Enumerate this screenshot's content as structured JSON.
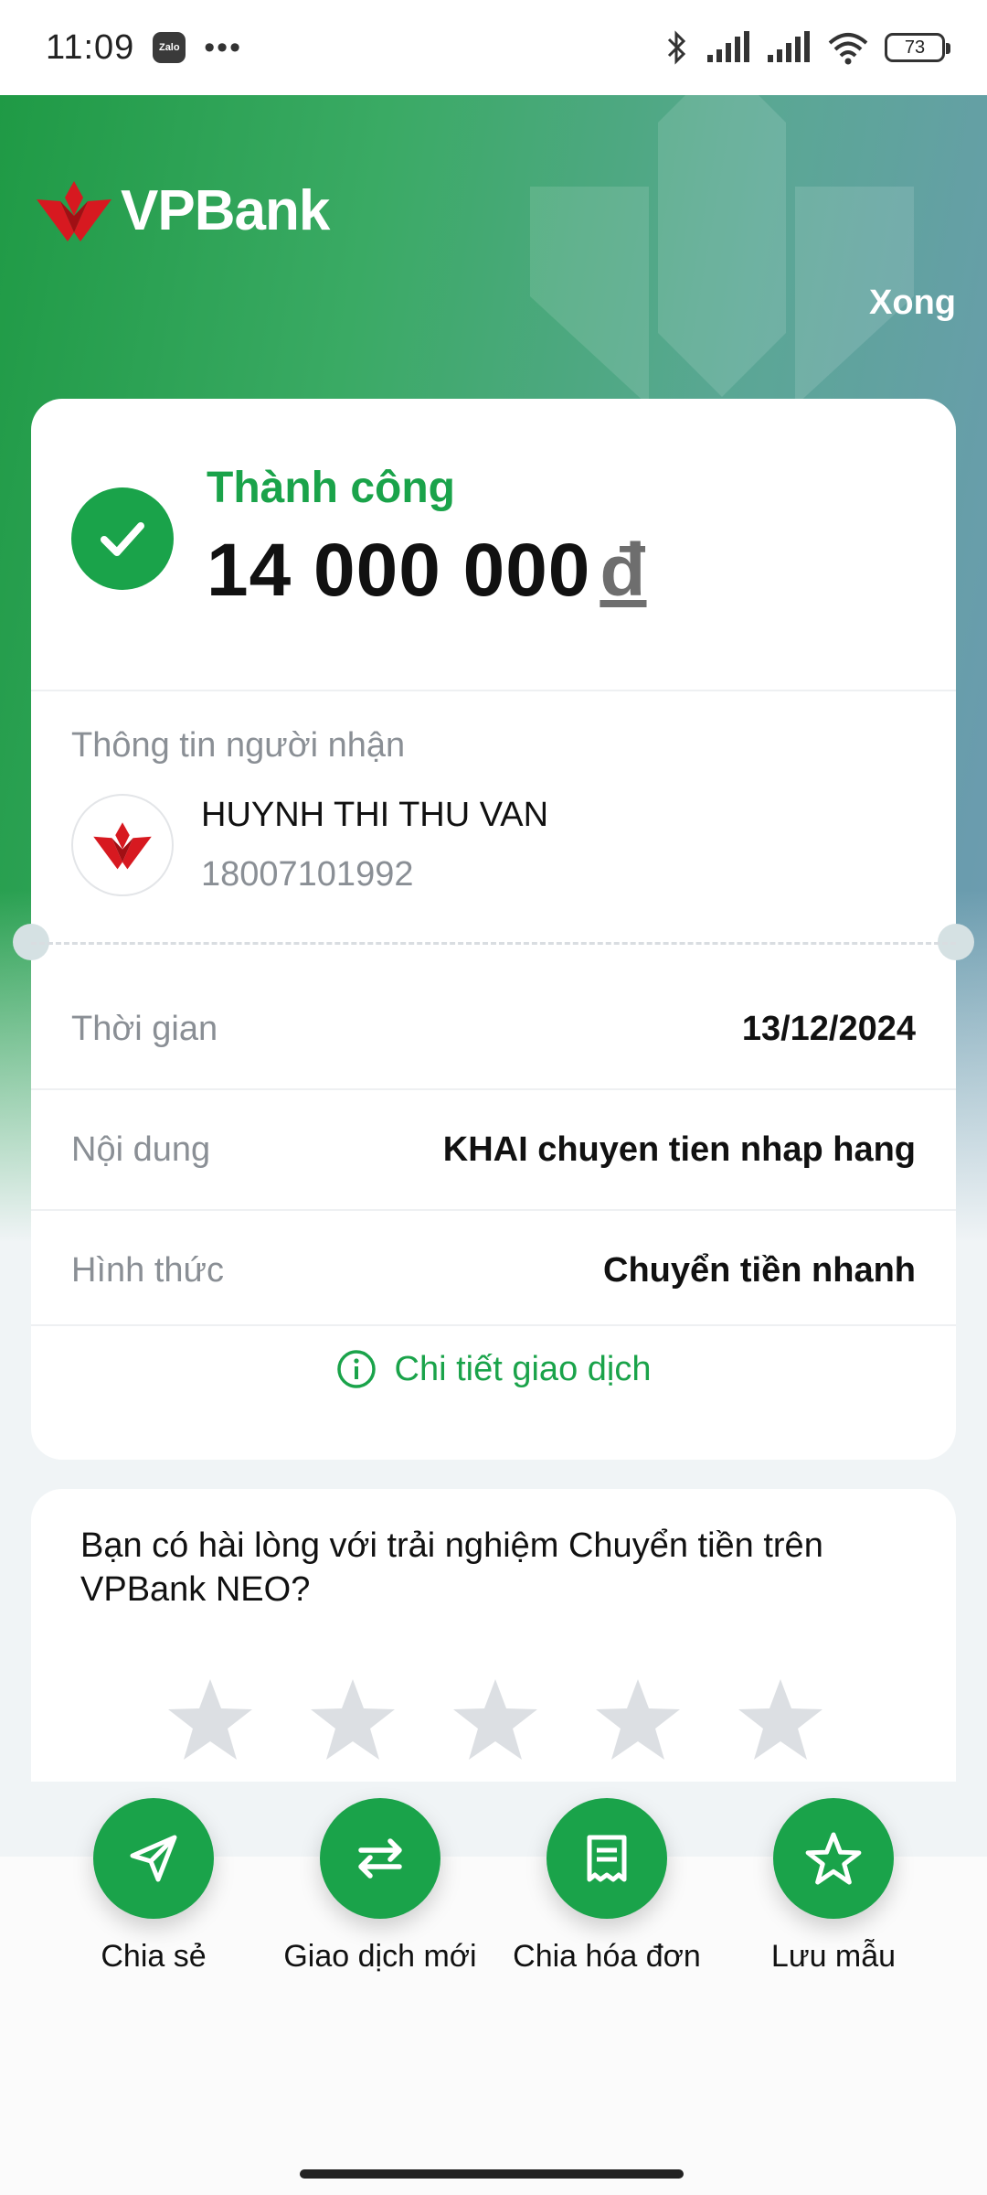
{
  "status_bar": {
    "time": "11:09",
    "notification_badge": "Zalo",
    "more_indicator": "•••",
    "battery": "73"
  },
  "header": {
    "brand": "VPBank",
    "done_label": "Xong"
  },
  "result": {
    "status": "Thành công",
    "amount": "14 000 000",
    "currency": "đ"
  },
  "recipient": {
    "section_title": "Thông tin người nhận",
    "name": "HUYNH THI THU VAN",
    "account": "18007101992"
  },
  "details": [
    {
      "label": "Thời gian",
      "value": "13/12/2024"
    },
    {
      "label": "Nội dung",
      "value": "KHAI chuyen tien nhap hang"
    },
    {
      "label": "Hình thức",
      "value": "Chuyển tiền nhanh"
    }
  ],
  "detail_link": "Chi tiết giao dịch",
  "feedback": {
    "question": "Bạn có hài lòng với trải nghiệm Chuyển tiền trên VPBank NEO?",
    "rating": 0,
    "max_rating": 5
  },
  "actions": [
    {
      "label": "Chia sẻ",
      "icon": "send-icon"
    },
    {
      "label": "Giao dịch mới",
      "icon": "swap-icon"
    },
    {
      "label": "Chia hóa đơn",
      "icon": "receipt-icon"
    },
    {
      "label": "Lưu mẫu",
      "icon": "star-icon"
    }
  ],
  "colors": {
    "accent": "#1aa34a",
    "brand_red": "#d71920"
  }
}
